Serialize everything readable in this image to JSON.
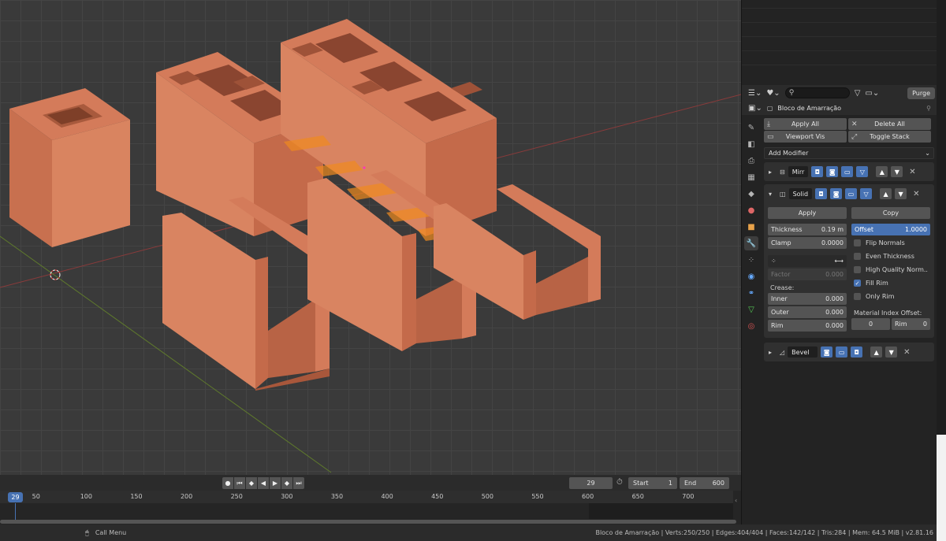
{
  "properties": {
    "header": {
      "purge_label": "Purge"
    },
    "object_name": "Bloco de Amarração",
    "buttons": {
      "apply_all": "Apply All",
      "delete_all": "Delete All",
      "viewport_vis": "Viewport Vis",
      "toggle_stack": "Toggle Stack"
    },
    "add_modifier": "Add Modifier",
    "modifiers": [
      {
        "name": "Mirr"
      },
      {
        "name": "Solid",
        "apply": "Apply",
        "copy": "Copy",
        "thickness_label": "Thickness",
        "thickness_value": "0.19 m",
        "offset_label": "Offset",
        "offset_value": "1.0000",
        "clamp_label": "Clamp",
        "clamp_value": "0.0000",
        "factor_label": "Factor",
        "factor_value": "0.000",
        "crease_label": "Crease:",
        "inner_label": "Inner",
        "inner_value": "0.000",
        "outer_label": "Outer",
        "outer_value": "0.000",
        "rim_label": "Rim",
        "rim_value": "0.000",
        "checks": [
          {
            "label": "Flip Normals",
            "on": false
          },
          {
            "label": "Even Thickness",
            "on": false
          },
          {
            "label": "High Quality Norm..",
            "on": false
          },
          {
            "label": "Fill Rim",
            "on": true
          },
          {
            "label": "Only Rim",
            "on": false
          }
        ],
        "material_offset_label": "Material Index Offset:",
        "mat_value": "0",
        "mat_rim_label": "Rim",
        "mat_rim_value": "0"
      },
      {
        "name": "Bevel"
      }
    ]
  },
  "timeline": {
    "current_frame": "29",
    "start_label": "Start",
    "start_value": "1",
    "end_label": "End",
    "end_value": "600",
    "ruler_cursor": "29",
    "ticks": [
      "50",
      "100",
      "150",
      "200",
      "250",
      "300",
      "350",
      "400",
      "450",
      "500",
      "550",
      "600",
      "650",
      "700"
    ]
  },
  "status": {
    "call_menu": "Call Menu",
    "info": "Bloco de Amarração | Verts:250/250 | Edges:404/404 | Faces:142/142 | Tris:284 | Mem: 64.5 MiB | v2.81.16"
  }
}
